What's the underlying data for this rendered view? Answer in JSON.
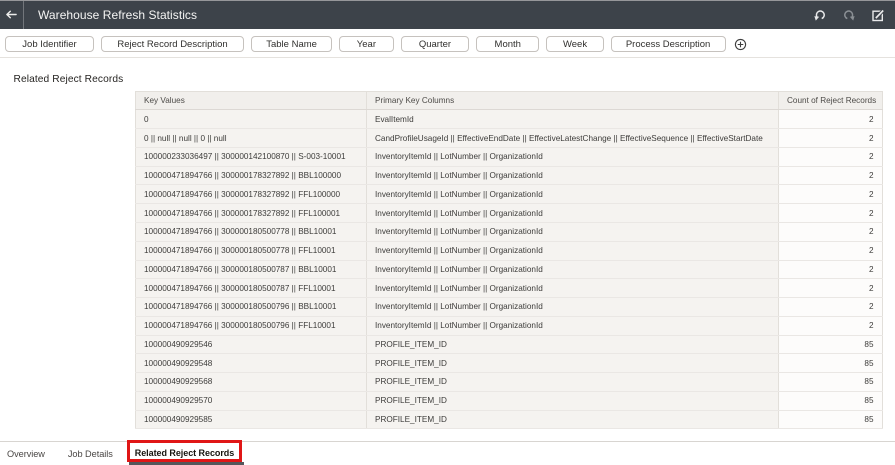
{
  "topbar": {
    "title": "Warehouse Refresh Statistics",
    "icons": [
      "back-arrow",
      "undo",
      "redo",
      "edit"
    ]
  },
  "filters": {
    "chips": [
      "Job Identifier",
      "Reject Record Description",
      "Table Name",
      "Year",
      "Quarter",
      "Month",
      "Week",
      "Process Description"
    ],
    "add_icon": "add-filter-circle-plus"
  },
  "section_title": "Related Reject Records",
  "table": {
    "columns": [
      "Key Values",
      "Primary Key Columns",
      "Count of Reject Records"
    ],
    "rows": [
      {
        "key": "0",
        "pk": "EvalItemId",
        "count": "2"
      },
      {
        "key": "0 || null || null || 0 || null",
        "pk": "CandProfileUsageId || EffectiveEndDate || EffectiveLatestChange || EffectiveSequence || EffectiveStartDate",
        "count": "2"
      },
      {
        "key": "100000233036497 || 300000142100870 || S-003-10001",
        "pk": "InventoryItemId || LotNumber || OrganizationId",
        "count": "2"
      },
      {
        "key": "100000471894766 || 300000178327892 || BBL100000",
        "pk": "InventoryItemId || LotNumber || OrganizationId",
        "count": "2"
      },
      {
        "key": "100000471894766 || 300000178327892 || FFL100000",
        "pk": "InventoryItemId || LotNumber || OrganizationId",
        "count": "2"
      },
      {
        "key": "100000471894766 || 300000178327892 || FFL100001",
        "pk": "InventoryItemId || LotNumber || OrganizationId",
        "count": "2"
      },
      {
        "key": "100000471894766 || 300000180500778 || BBL10001",
        "pk": "InventoryItemId || LotNumber || OrganizationId",
        "count": "2"
      },
      {
        "key": "100000471894766 || 300000180500778 || FFL10001",
        "pk": "InventoryItemId || LotNumber || OrganizationId",
        "count": "2"
      },
      {
        "key": "100000471894766 || 300000180500787 || BBL10001",
        "pk": "InventoryItemId || LotNumber || OrganizationId",
        "count": "2"
      },
      {
        "key": "100000471894766 || 300000180500787 || FFL10001",
        "pk": "InventoryItemId || LotNumber || OrganizationId",
        "count": "2"
      },
      {
        "key": "100000471894766 || 300000180500796 || BBL10001",
        "pk": "InventoryItemId || LotNumber || OrganizationId",
        "count": "2"
      },
      {
        "key": "100000471894766 || 300000180500796 || FFL10001",
        "pk": "InventoryItemId || LotNumber || OrganizationId",
        "count": "2"
      },
      {
        "key": "100000490929546",
        "pk": "PROFILE_ITEM_ID",
        "count": "85"
      },
      {
        "key": "100000490929548",
        "pk": "PROFILE_ITEM_ID",
        "count": "85"
      },
      {
        "key": "100000490929568",
        "pk": "PROFILE_ITEM_ID",
        "count": "85"
      },
      {
        "key": "100000490929570",
        "pk": "PROFILE_ITEM_ID",
        "count": "85"
      },
      {
        "key": "100000490929585",
        "pk": "PROFILE_ITEM_ID",
        "count": "85"
      }
    ]
  },
  "tabs": {
    "overview": "Overview",
    "job_details": "Job Details",
    "related": "Related Reject Records",
    "active": "Related Reject Records"
  },
  "colors": {
    "topbar_background": "#3d434a",
    "annotation_red": "#e01616",
    "active_tab_underline": "#54575b"
  }
}
